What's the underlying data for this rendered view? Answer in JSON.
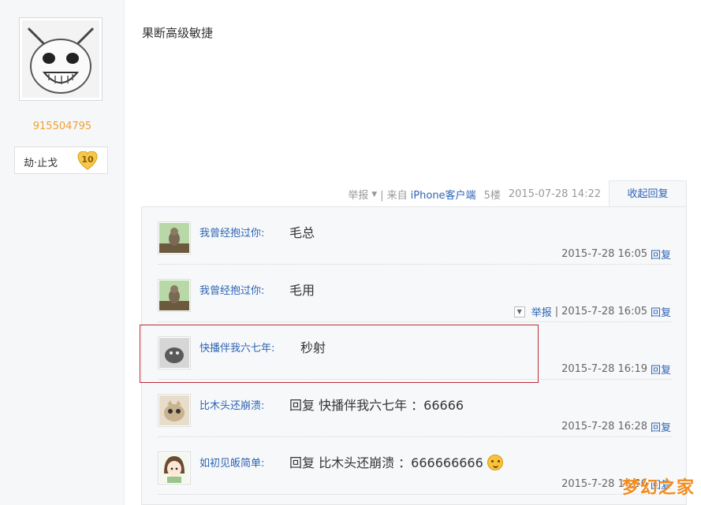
{
  "author": {
    "username": "915504795",
    "badge_name": "劫·止戈",
    "badge_level": "10"
  },
  "post": {
    "content": "果断高级敏捷",
    "meta": {
      "report": "举报",
      "source_prefix": "| 来自",
      "source_link": "iPhone客户端",
      "floor": "5楼",
      "datetime": "2015-07-28 14:22"
    },
    "collapse_label": "收起回复"
  },
  "replies": [
    {
      "user": "我曾经抱过你:",
      "text": "毛总",
      "time": "2015-7-28 16:05",
      "reply_label": "回复"
    },
    {
      "user": "我曾经抱过你:",
      "text": "毛用",
      "time": "2015-7-28 16:05",
      "reply_label": "回复",
      "report_label": "举报"
    },
    {
      "user": "快播伴我六七年:",
      "text": "秒射",
      "time": "2015-7-28 16:19",
      "reply_label": "回复"
    },
    {
      "user": "比木头还崩溃:",
      "text": "回复 快播伴我六七年 ：66666",
      "time": "2015-7-28 16:28",
      "reply_label": "回复"
    },
    {
      "user": "如初见皈简单:",
      "text": "回复 比木头还崩溃 ：666666666",
      "time": "2015-7-28 16:30",
      "reply_label": "回复"
    }
  ],
  "watermark": "梦幻之家",
  "colors": {
    "link": "#2d64b3",
    "username": "#f0a030",
    "highlight": "#b82b38",
    "watermark": "#f28b1e"
  }
}
